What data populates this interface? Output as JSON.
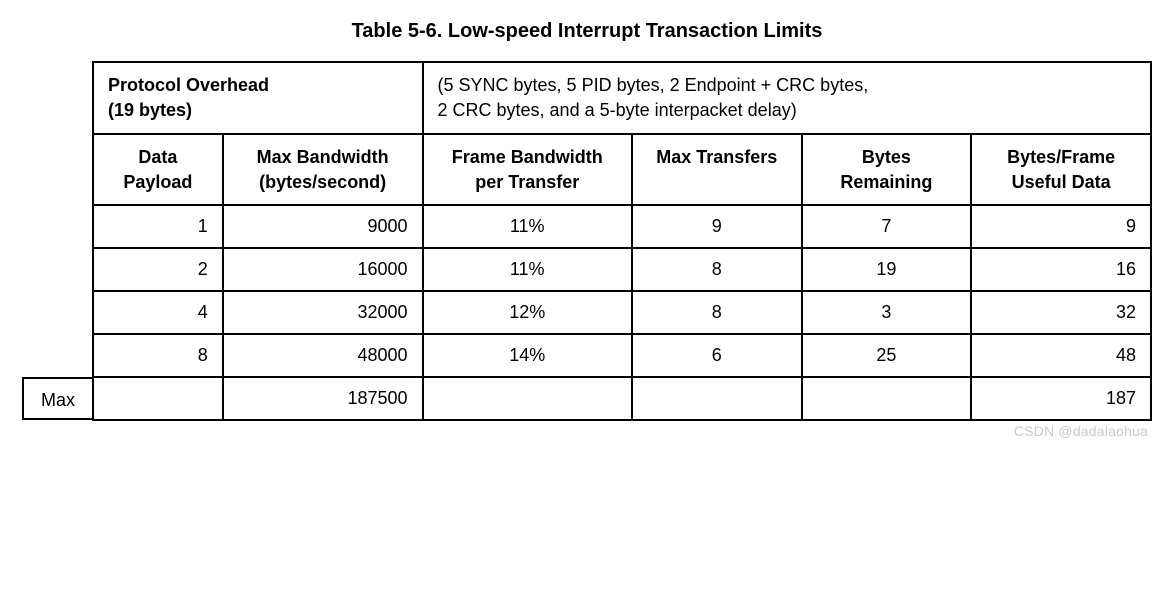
{
  "caption": "Table 5-6.  Low-speed Interrupt Transaction Limits",
  "header": {
    "protocol_overhead_label": "Protocol Overhead",
    "protocol_overhead_bytes": "(19 bytes)",
    "protocol_overhead_desc_line1": "(5 SYNC bytes, 5 PID bytes, 2 Endpoint + CRC bytes,",
    "protocol_overhead_desc_line2": "2 CRC bytes, and a 5-byte interpacket delay)"
  },
  "columns": {
    "c0": "Data Payload",
    "c1": "Max Bandwidth (bytes/second)",
    "c2": "Frame Bandwidth per Transfer",
    "c3": "Max Transfers",
    "c4": "Bytes Remaining",
    "c5": "Bytes/Frame Useful Data"
  },
  "rows": [
    {
      "payload": "1",
      "max_bw": "9000",
      "frame_bw": "11%",
      "max_xfer": "9",
      "bytes_rem": "7",
      "useful": "9"
    },
    {
      "payload": "2",
      "max_bw": "16000",
      "frame_bw": "11%",
      "max_xfer": "8",
      "bytes_rem": "19",
      "useful": "16"
    },
    {
      "payload": "4",
      "max_bw": "32000",
      "frame_bw": "12%",
      "max_xfer": "8",
      "bytes_rem": "3",
      "useful": "32"
    },
    {
      "payload": "8",
      "max_bw": "48000",
      "frame_bw": "14%",
      "max_xfer": "6",
      "bytes_rem": "25",
      "useful": "48"
    }
  ],
  "max_row": {
    "label": "Max",
    "payload": "",
    "max_bw": "187500",
    "frame_bw": "",
    "max_xfer": "",
    "bytes_rem": "",
    "useful": "187"
  },
  "watermark": "CSDN @dadalaohua",
  "chart_data": {
    "type": "table",
    "title": "Table 5-6. Low-speed Interrupt Transaction Limits",
    "columns": [
      "Data Payload",
      "Max Bandwidth (bytes/second)",
      "Frame Bandwidth per Transfer",
      "Max Transfers",
      "Bytes Remaining",
      "Bytes/Frame Useful Data"
    ],
    "rows": [
      [
        1,
        9000,
        "11%",
        9,
        7,
        9
      ],
      [
        2,
        16000,
        "11%",
        8,
        19,
        16
      ],
      [
        4,
        32000,
        "12%",
        8,
        3,
        32
      ],
      [
        8,
        48000,
        "14%",
        6,
        25,
        48
      ],
      [
        "Max",
        187500,
        null,
        null,
        null,
        187
      ]
    ],
    "protocol_overhead_bytes": 19
  }
}
